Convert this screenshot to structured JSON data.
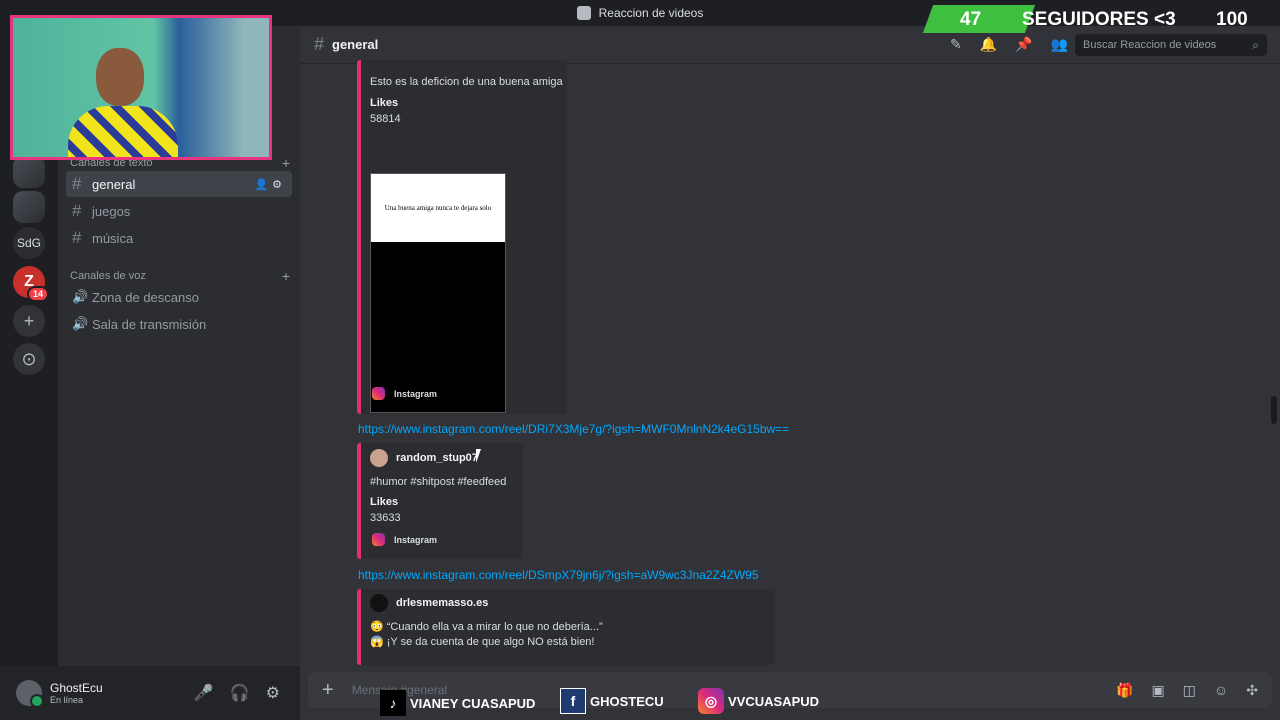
{
  "window": {
    "title": "Reaccion de videos"
  },
  "overlay": {
    "count_left": "47",
    "label": "SEGUIDORES <3",
    "goal": "100"
  },
  "servers": [
    {
      "label": "",
      "icon": "server-image-1"
    },
    {
      "label": "",
      "icon": "server-image-ghost"
    },
    {
      "label": "SdG"
    },
    {
      "label": "Z",
      "badge": "14"
    },
    {
      "label": "+",
      "icon": "add-server-icon"
    },
    {
      "label": "⊙",
      "icon": "explore-icon"
    }
  ],
  "sidebar": {
    "text_category": "Canales de texto",
    "text_channels": [
      "general",
      "juegos",
      "música"
    ],
    "voice_category": "Canales de voz",
    "voice_channels": [
      "Zona de descanso",
      "Sala de transmisión"
    ]
  },
  "user": {
    "name": "GhostEcu",
    "status": "En línea"
  },
  "channel": {
    "name": "general",
    "search_placeholder": "Buscar Reaccion de videos"
  },
  "messages": {
    "embed1": {
      "description": "Esto es la deficion de una buena amiga",
      "likes_label": "Likes",
      "likes": "58814",
      "thumb_text": "Una buena amiga nunca te dejara solo",
      "provider": "Instagram"
    },
    "link2": "https://www.instagram.com/reel/DRi7X3Mje7g/?igsh=MWF0MnlnN2k4eG15bw==",
    "embed2": {
      "author": "random_stup07",
      "description": "#humor #shitpost #feedfeed",
      "likes_label": "Likes",
      "likes": "33633",
      "provider": "Instagram"
    },
    "link3": "https://www.instagram.com/reel/DSmpX79jn6j/?igsh=aW9wc3Jna2Z4ZW95",
    "embed3": {
      "author": "drlesmemasso.es",
      "line1": "“Cuando ella va a mirar lo que no debería...”",
      "line2": "¡Y se da cuenta de que algo NO está bien!"
    }
  },
  "composer": {
    "placeholder": "Mensaje #general"
  },
  "socials": [
    {
      "icon": "tiktok-icon",
      "label": "VIANEY CUASAPUD"
    },
    {
      "icon": "facebook-icon",
      "label": "GHOSTECU"
    },
    {
      "icon": "instagram-icon",
      "label": "VVCUASAPUD"
    }
  ],
  "colors": {
    "accent": "#e1306c",
    "link": "#00a8fc",
    "follow_bar": "#3fbf3f"
  }
}
